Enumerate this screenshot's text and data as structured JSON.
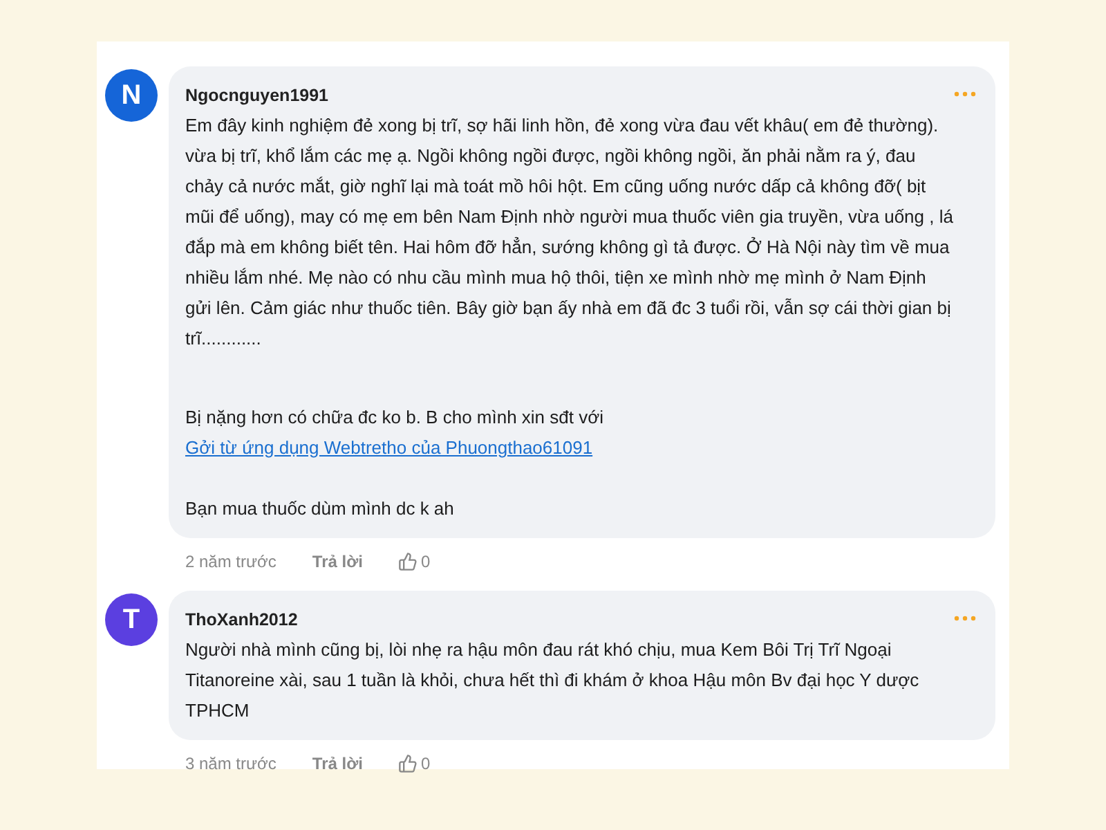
{
  "comments": [
    {
      "avatar": "N",
      "color": "#1565d8",
      "author": "Ngocnguyen1991",
      "blocks": [
        {
          "lines": [
            {
              "kind": "text",
              "text": "Em đây kinh nghiệm đẻ xong bị trĩ, sợ hãi linh hồn, đẻ xong vừa đau vết khâu( em đẻ thường). vừa bị trĩ, khổ lắm các mẹ ạ. Ngồi không ngồi được, ngồi không ngồi, ăn phải nằm ra ý, đau chảy cả nước mắt, giờ nghĩ lại mà toát mồ hôi hột. Em cũng uống nước dấp cả không đỡ( bịt mũi để uống), may có mẹ em bên Nam Định nhờ người mua thuốc viên gia truyền, vừa uống , lá đắp mà em không biết tên. Hai hôm đỡ hẳn, sướng không gì tả được. Ở Hà Nội này tìm về mua nhiều lắm nhé. Mẹ nào có nhu cầu mình mua hộ thôi, tiện xe mình nhờ mẹ mình ở Nam Định gửi lên. Cảm giác như thuốc tiên. Bây giờ bạn ấy nhà em đã đc 3 tuổi rồi, vẫn sợ cái thời gian bị trĩ............"
            }
          ]
        },
        {
          "lines": [
            {
              "kind": "text",
              "text": "Bị nặng hơn có chữa đc ko b. B cho mình xin sđt với"
            },
            {
              "kind": "link",
              "text": "Gởi từ ứng dụng Webtretho của Phuongthao61091"
            }
          ]
        },
        {
          "lines": [
            {
              "kind": "text",
              "text": "Bạn mua thuốc dùm mình dc k ah"
            }
          ]
        }
      ],
      "time": "2 năm trước",
      "reply": "Trả lời",
      "likes": "0"
    },
    {
      "avatar": "T",
      "color": "#5b3fe0",
      "author": "ThoXanh2012",
      "blocks": [
        {
          "lines": [
            {
              "kind": "text",
              "text": "Người nhà mình cũng bị, lòi nhẹ ra hậu môn đau rát khó chịu, mua Kem Bôi Trị Trĩ Ngoại Titanoreine xài, sau 1 tuần là khỏi, chưa hết thì đi khám ở khoa Hậu môn Bv đại học Y dược TPHCM"
            }
          ]
        }
      ],
      "time": "3 năm trước",
      "reply": "Trả lời",
      "likes": "0"
    }
  ]
}
